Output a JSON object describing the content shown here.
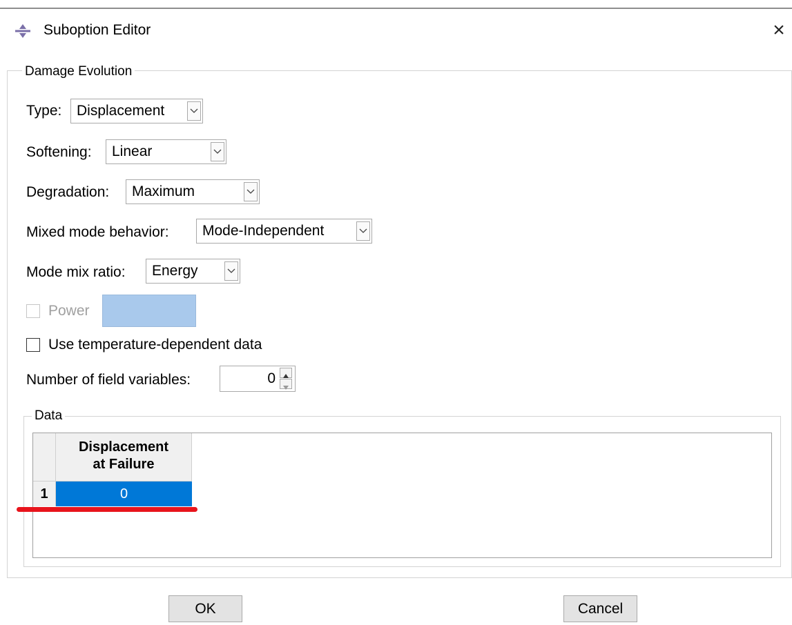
{
  "window": {
    "title": "Suboption Editor",
    "close_glyph": "×",
    "icon": "abaqus-app-icon"
  },
  "damage_evolution": {
    "legend": "Damage Evolution",
    "type": {
      "label": "Type:",
      "value": "Displacement"
    },
    "softening": {
      "label": "Softening:",
      "value": "Linear"
    },
    "degradation": {
      "label": "Degradation:",
      "value": "Maximum"
    },
    "mixed_mode": {
      "label": "Mixed mode behavior:",
      "value": "Mode-Independent"
    },
    "mode_mix_ratio": {
      "label": "Mode mix ratio:",
      "value": "Energy"
    },
    "power": {
      "label": "Power",
      "checked": false,
      "enabled": false,
      "value": ""
    },
    "temp_dependent": {
      "label": "Use temperature-dependent data",
      "checked": false
    },
    "field_variables": {
      "label": "Number of field variables:",
      "value": "0"
    }
  },
  "data_table": {
    "legend": "Data",
    "column_header_line1": "Displacement",
    "column_header_line2": "at Failure",
    "rows": [
      {
        "index": "1",
        "value": "0"
      }
    ]
  },
  "buttons": {
    "ok": "OK",
    "cancel": "Cancel"
  },
  "colors": {
    "selection": "#0078d7",
    "annotation_underline": "#e8141c",
    "disabled_field": "#a9c9ec"
  }
}
